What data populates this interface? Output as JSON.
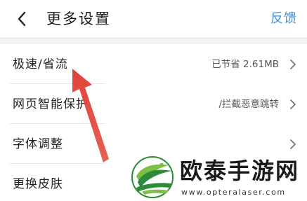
{
  "header": {
    "title": "更多设置",
    "feedback_label": "反馈",
    "accent_color": "#3f8fd8"
  },
  "settings": [
    {
      "label": "极速/省流",
      "value": "已节省 2.61MB",
      "icon": "chevron-right-icon"
    },
    {
      "label": "网页智能保护",
      "value": "/拦截恶意跳转",
      "icon": "chevron-right-icon"
    },
    {
      "label": "字体调整",
      "value": "",
      "icon": "chevron-right-icon"
    },
    {
      "label": "更换皮肤",
      "value": "",
      "icon": ""
    }
  ],
  "annotation": {
    "type": "red-arrow",
    "color": "#e0443a",
    "points_to": "极速/省流"
  },
  "watermark": {
    "brand": "欧泰手游网",
    "url": "www.opteralaser.com",
    "logo_colors": [
      "#2e8b3a",
      "#7cc242"
    ]
  }
}
